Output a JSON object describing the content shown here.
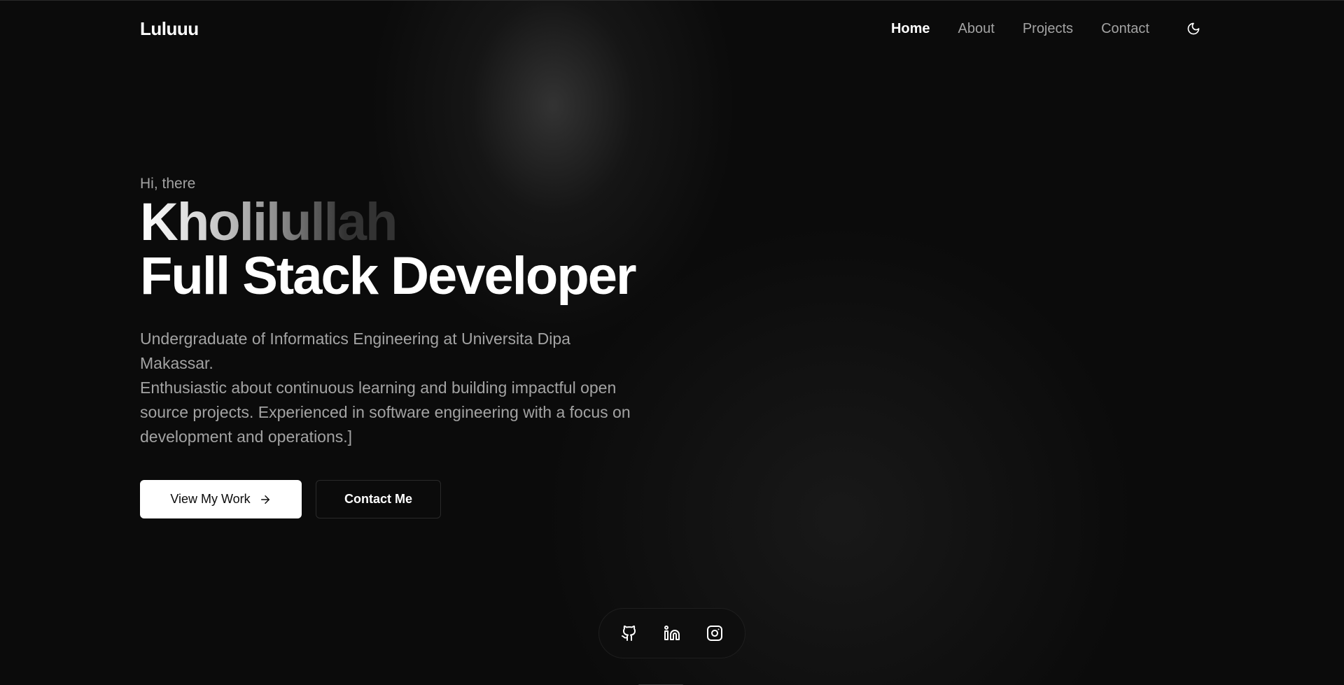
{
  "nav": {
    "logo": "Luluuu",
    "links": [
      {
        "label": "Home",
        "active": true
      },
      {
        "label": "About",
        "active": false
      },
      {
        "label": "Projects",
        "active": false
      },
      {
        "label": "Contact",
        "active": false
      }
    ],
    "theme_toggle_icon": "moon-icon"
  },
  "hero": {
    "greeting": "Hi, there",
    "name": "Kholilullah",
    "role": "Full Stack Developer",
    "description_line1": "Undergraduate of Informatics Engineering at Universita Dipa Makassar.",
    "description_line2": "Enthusiastic about continuous learning and building impactful open source projects. Experienced in software engineering with a focus on development and operations.]",
    "primary_button": "View My Work",
    "primary_button_icon": "arrow-right-icon",
    "secondary_button": "Contact Me"
  },
  "social": [
    {
      "icon": "github-icon"
    },
    {
      "icon": "linkedin-icon"
    },
    {
      "icon": "instagram-icon"
    }
  ],
  "colors": {
    "background": "#0b0b0b",
    "text_primary": "#ffffff",
    "text_muted": "#a3a3a3"
  }
}
